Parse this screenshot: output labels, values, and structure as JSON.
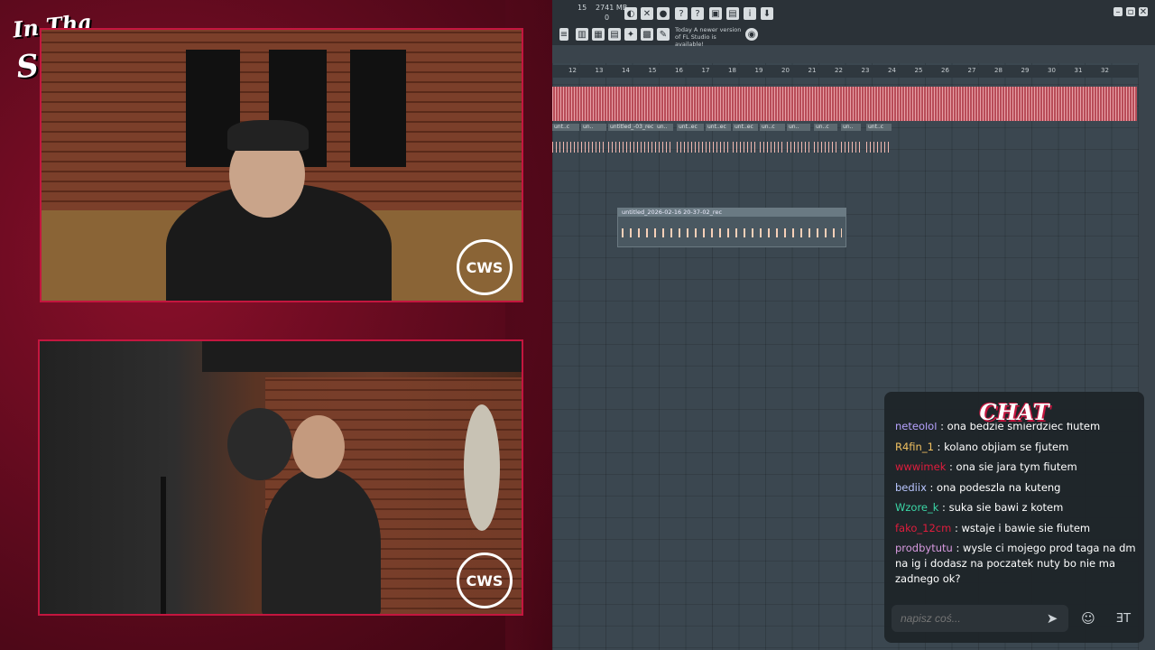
{
  "overlay": {
    "brand_line1": "In Tha",
    "brand_line2": "Studio!",
    "cam_logo_top": "CWS",
    "cam_logo_bottom": "CWS"
  },
  "daw": {
    "toolbar": {
      "cpu": "15",
      "memory": "2741 MB",
      "memory_sub": "0",
      "news_label": "Today",
      "news_text": "A newer version of FL Studio is available!"
    },
    "ruler_ticks": [
      "12",
      "13",
      "14",
      "15",
      "16",
      "17",
      "18",
      "19",
      "20",
      "21",
      "22",
      "23",
      "24",
      "25",
      "26",
      "27",
      "28",
      "29",
      "30",
      "31",
      "32"
    ],
    "clips_track2": [
      "unt..c",
      "un..",
      "untitled_-03_rec",
      "un..",
      "unt..ec",
      "unt..ec",
      "unt..ec",
      "un..c",
      "un..",
      "un..c",
      "un..",
      "unt..c"
    ],
    "clip3_title": "untitled_2026-02-16 20-37-02_rec"
  },
  "chat": {
    "title": "CHAT",
    "messages": [
      {
        "user": "neteolol",
        "text": " : ona bedzie smierdziec fiutem",
        "color": "#b7a3ff"
      },
      {
        "user": "R4fin_1",
        "text": " : kolano objiam se fjutem",
        "color": "#f0c060"
      },
      {
        "user": "wwwimek",
        "text": " : ona sie jara tym fiutem",
        "color": "#e01d3d"
      },
      {
        "user": "bediix",
        "text": " : ona podeszla na kuteng",
        "color": "#b9c6ff"
      },
      {
        "user": "Wzore_k",
        "text": " : suka sie bawi z kotem",
        "color": "#3bd6a6"
      },
      {
        "user": "fako_12cm",
        "text": " : wstaje i bawie sie fiutem",
        "color": "#e01d3d"
      },
      {
        "user": "prodbytutu",
        "text": " : wysle ci mojego prod taga na dm na ig i dodasz na poczatek nuty bo nie ma zadnego ok?",
        "color": "#d89ae0"
      }
    ],
    "input_placeholder": "napisz coś...",
    "send_icon": "send-icon",
    "emoji_icon": "emoji-icon",
    "emote_label": "ƎT"
  }
}
